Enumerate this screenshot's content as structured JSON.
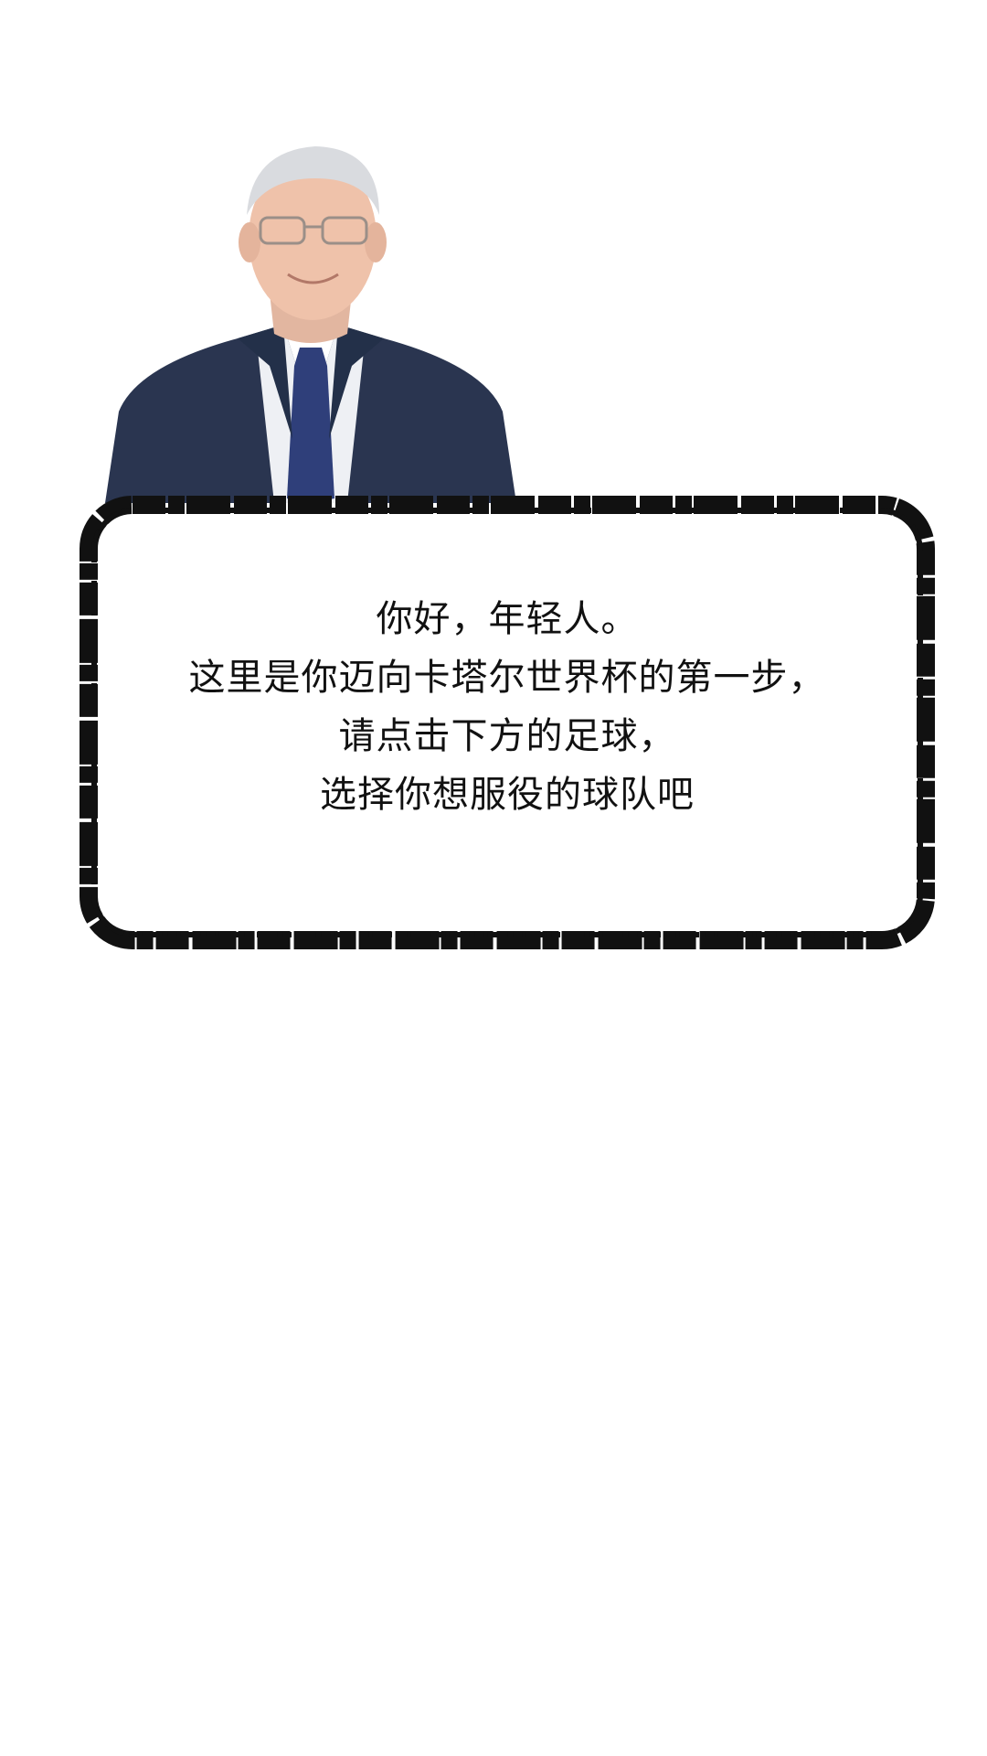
{
  "dialog": {
    "speaker_image": "manager-portrait",
    "lines": [
      "你好，年轻人。",
      "这里是你迈向卡塔尔世界杯的第一步，",
      "请点击下方的足球，",
      "选择你想服役的球队吧"
    ]
  },
  "colors": {
    "background": "#ffffff",
    "frame": "#111111",
    "text": "#111111",
    "suit": "#2a3550",
    "tie": "#2f3f7a"
  }
}
